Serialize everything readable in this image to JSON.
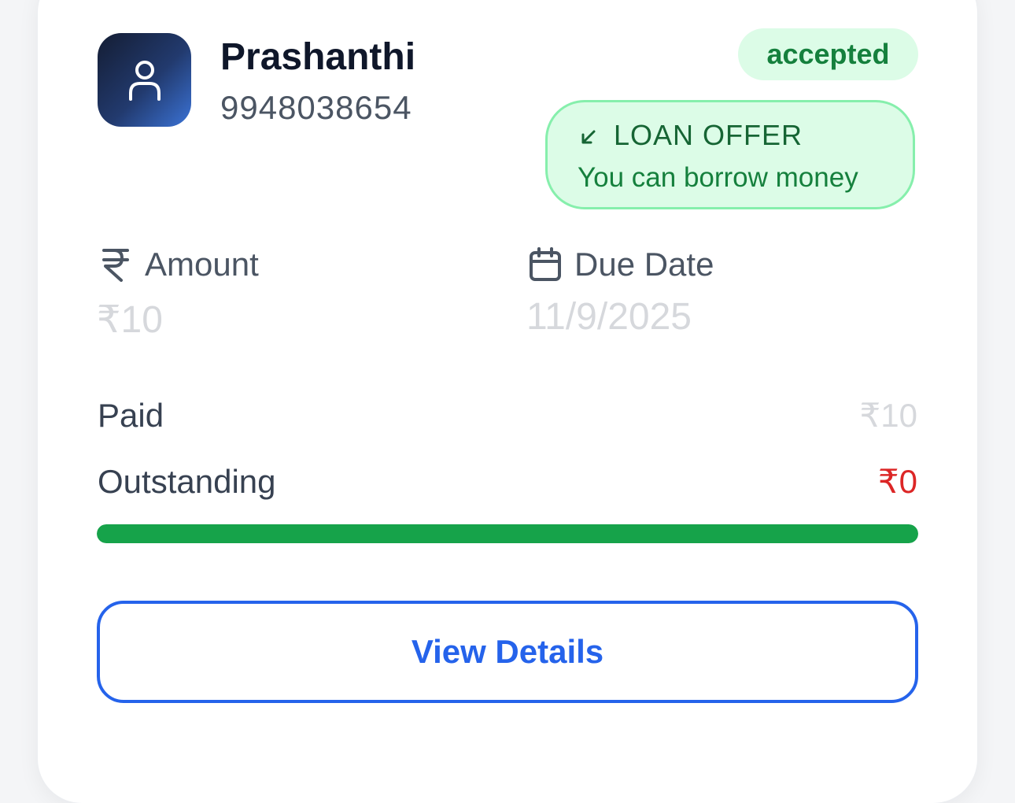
{
  "borrower": {
    "name": "Prashanthi",
    "phone": "9948038654",
    "avatar_icon": "user-icon"
  },
  "status": {
    "label": "accepted",
    "color": "#15803d",
    "background": "#dcfce7"
  },
  "offer": {
    "icon": "arrow-down-left-icon",
    "title": "LOAN OFFER",
    "subtitle": "You can borrow money"
  },
  "amount": {
    "icon": "rupee-icon",
    "label": "Amount",
    "value": "₹10"
  },
  "due_date": {
    "icon": "calendar-icon",
    "label": "Due Date",
    "value": "11/9/2025"
  },
  "paid": {
    "label": "Paid",
    "value": "₹10"
  },
  "outstanding": {
    "label": "Outstanding",
    "value": "₹0",
    "color": "#dc2626"
  },
  "progress": {
    "fraction": 1.0,
    "color": "#16a34a"
  },
  "actions": {
    "view_details_label": "View Details",
    "accent": "#2563eb"
  }
}
